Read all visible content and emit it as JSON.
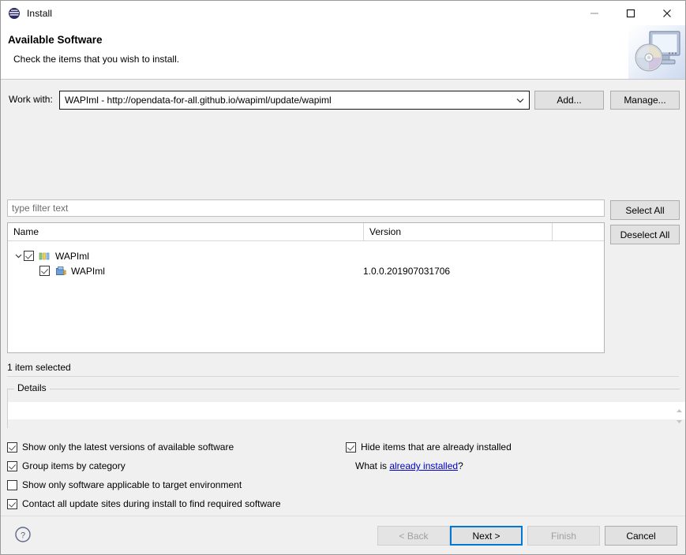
{
  "window": {
    "title": "Install",
    "icon": "eclipse-icon",
    "controls": {
      "minimize": "minimize-icon",
      "maximize": "maximize-icon",
      "close": "close-icon"
    }
  },
  "header": {
    "title": "Available Software",
    "subtitle": "Check the items that you wish to install.",
    "graphic": "monitor-cd-icon"
  },
  "work_with": {
    "label": "Work with:",
    "value": "WAPIml - http://opendata-for-all.github.io/wapiml/update/wapiml",
    "dropdown_icon": "chevron-down-icon",
    "add_label": "Add...",
    "manage_label": "Manage..."
  },
  "filter": {
    "placeholder": "type filter text",
    "value": ""
  },
  "selection_buttons": {
    "select_all": "Select All",
    "deselect_all": "Deselect All"
  },
  "tree": {
    "columns": [
      "Name",
      "Version",
      ""
    ],
    "rows": [
      {
        "level": 0,
        "expanded": true,
        "twisty": "chevron-down-icon",
        "checked": true,
        "icon": "category-icon",
        "name": "WAPIml",
        "version": ""
      },
      {
        "level": 1,
        "expanded": false,
        "twisty": "",
        "checked": true,
        "icon": "feature-plugin-icon",
        "name": "WAPIml",
        "version": "1.0.0.201907031706"
      }
    ]
  },
  "status": {
    "text": "1 item selected"
  },
  "details": {
    "legend": "Details",
    "value": "",
    "scroll_up_icon": "scroll-up-icon",
    "scroll_down_icon": "scroll-down-icon"
  },
  "options": {
    "left": [
      {
        "label": "Show only the latest versions of available software",
        "checked": true
      },
      {
        "label": "Group items by category",
        "checked": true
      },
      {
        "label": "Show only software applicable to target environment",
        "checked": false
      },
      {
        "label": "Contact all update sites during install to find required software",
        "checked": true
      }
    ],
    "right": [
      {
        "label": "Hide items that are already installed",
        "checked": true
      }
    ],
    "what_is_prefix": "What is ",
    "what_is_link": "already installed",
    "what_is_suffix": "?"
  },
  "footer": {
    "help_icon": "help-icon",
    "buttons": [
      {
        "label": "< Back",
        "state": "disabled"
      },
      {
        "label": "Next >",
        "state": "focused"
      },
      {
        "label": "Finish",
        "state": "disabled"
      },
      {
        "label": "Cancel",
        "state": "normal"
      }
    ]
  },
  "colors": {
    "accent": "#0078d7",
    "link": "#0000cc",
    "window_bg": "#f0f0f0",
    "field_bg": "#ffffff"
  }
}
